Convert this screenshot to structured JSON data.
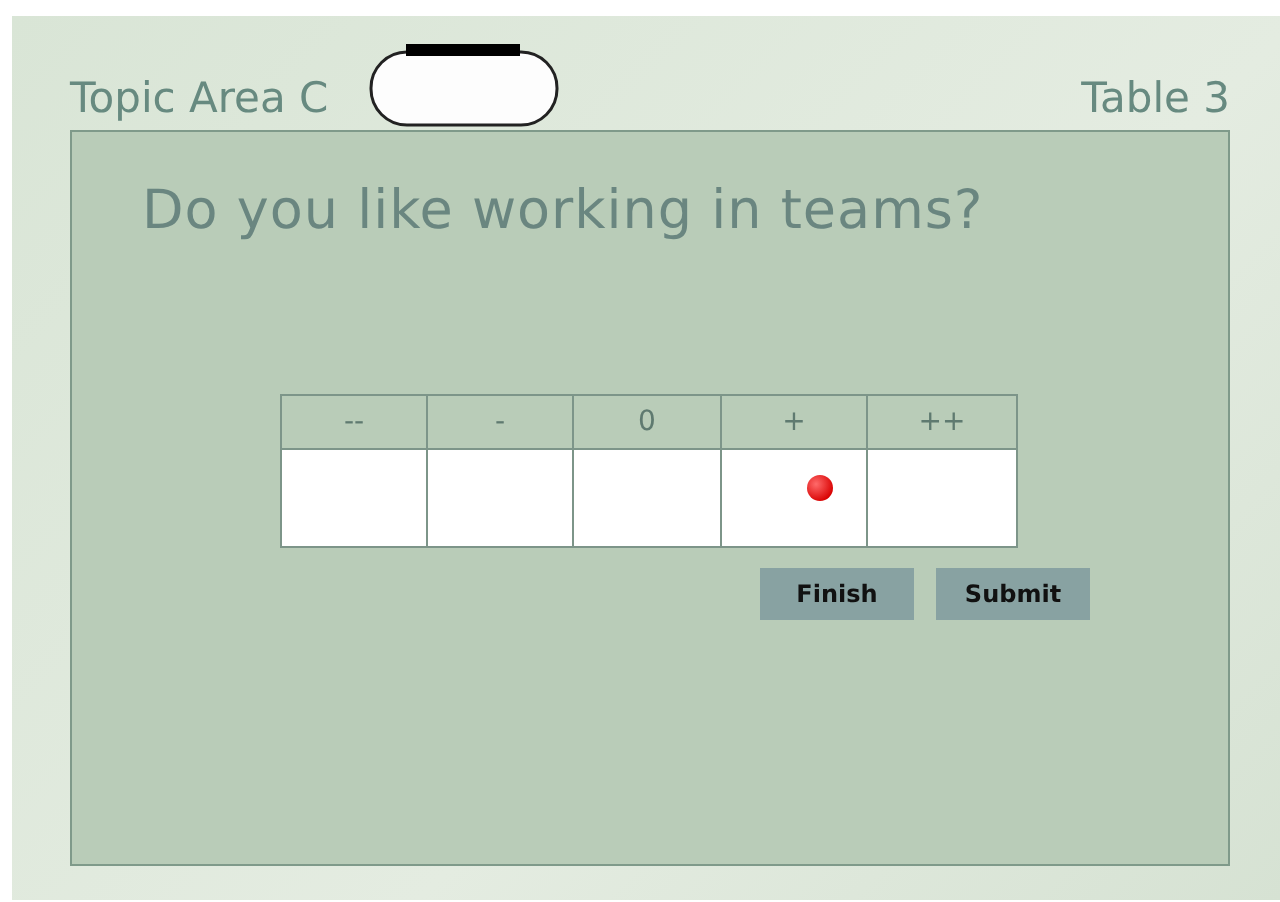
{
  "header": {
    "topic": "Topic Area C",
    "table": "Table 3"
  },
  "question": "Do you like working in teams?",
  "scale": [
    {
      "label": "--",
      "selected": false
    },
    {
      "label": "-",
      "selected": false
    },
    {
      "label": "0",
      "selected": false
    },
    {
      "label": "+",
      "selected": true
    },
    {
      "label": "++",
      "selected": false
    }
  ],
  "buttons": [
    "Finish",
    "Submit"
  ]
}
